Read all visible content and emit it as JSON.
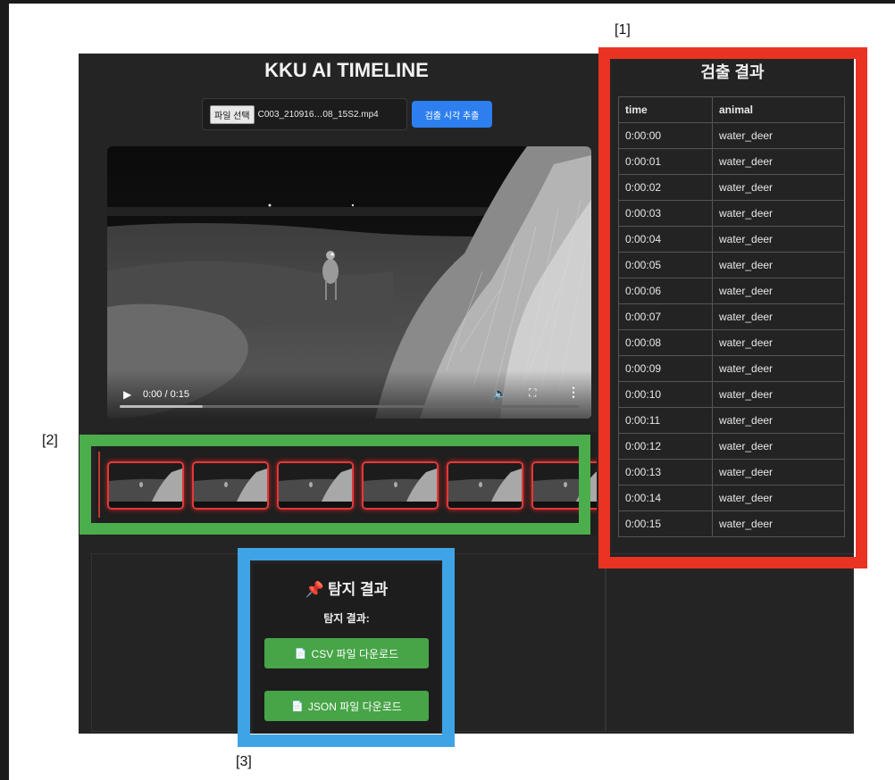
{
  "app": {
    "title": "KKU AI TIMELINE",
    "file_picker": {
      "button_label": "파일 선택",
      "file_name": "C003_210916…08_15S2.mp4"
    },
    "extract_button_label": "검출 시각 추출"
  },
  "video": {
    "time_display": "0:00 / 0:15",
    "progress": 0.18,
    "icons": [
      "play-icon",
      "volume-icon",
      "fullscreen-icon",
      "more-icon"
    ]
  },
  "thumbnail_strip": {
    "thumbnail_count": 6
  },
  "detection_results": {
    "title": "검출 결과",
    "columns": [
      "time",
      "animal"
    ],
    "rows": [
      [
        "0:00:00",
        "water_deer"
      ],
      [
        "0:00:01",
        "water_deer"
      ],
      [
        "0:00:02",
        "water_deer"
      ],
      [
        "0:00:03",
        "water_deer"
      ],
      [
        "0:00:04",
        "water_deer"
      ],
      [
        "0:00:05",
        "water_deer"
      ],
      [
        "0:00:06",
        "water_deer"
      ],
      [
        "0:00:07",
        "water_deer"
      ],
      [
        "0:00:08",
        "water_deer"
      ],
      [
        "0:00:09",
        "water_deer"
      ],
      [
        "0:00:10",
        "water_deer"
      ],
      [
        "0:00:11",
        "water_deer"
      ],
      [
        "0:00:12",
        "water_deer"
      ],
      [
        "0:00:13",
        "water_deer"
      ],
      [
        "0:00:14",
        "water_deer"
      ],
      [
        "0:00:15",
        "water_deer"
      ]
    ]
  },
  "results_panel": {
    "title": "탐지 결과",
    "subtitle": "탐지 결과:",
    "csv_button_label": "CSV 파일 다운로드",
    "json_button_label": "JSON 파일 다운로드"
  },
  "annotations": {
    "label_1": "[1]",
    "label_2": "[2]",
    "label_3": "[3]"
  },
  "colors": {
    "annotation_red": "#ea3323",
    "annotation_green": "#4cad4c",
    "annotation_blue": "#3fa4e6",
    "primary_button": "#2d7ff0",
    "download_button": "#47a447"
  }
}
